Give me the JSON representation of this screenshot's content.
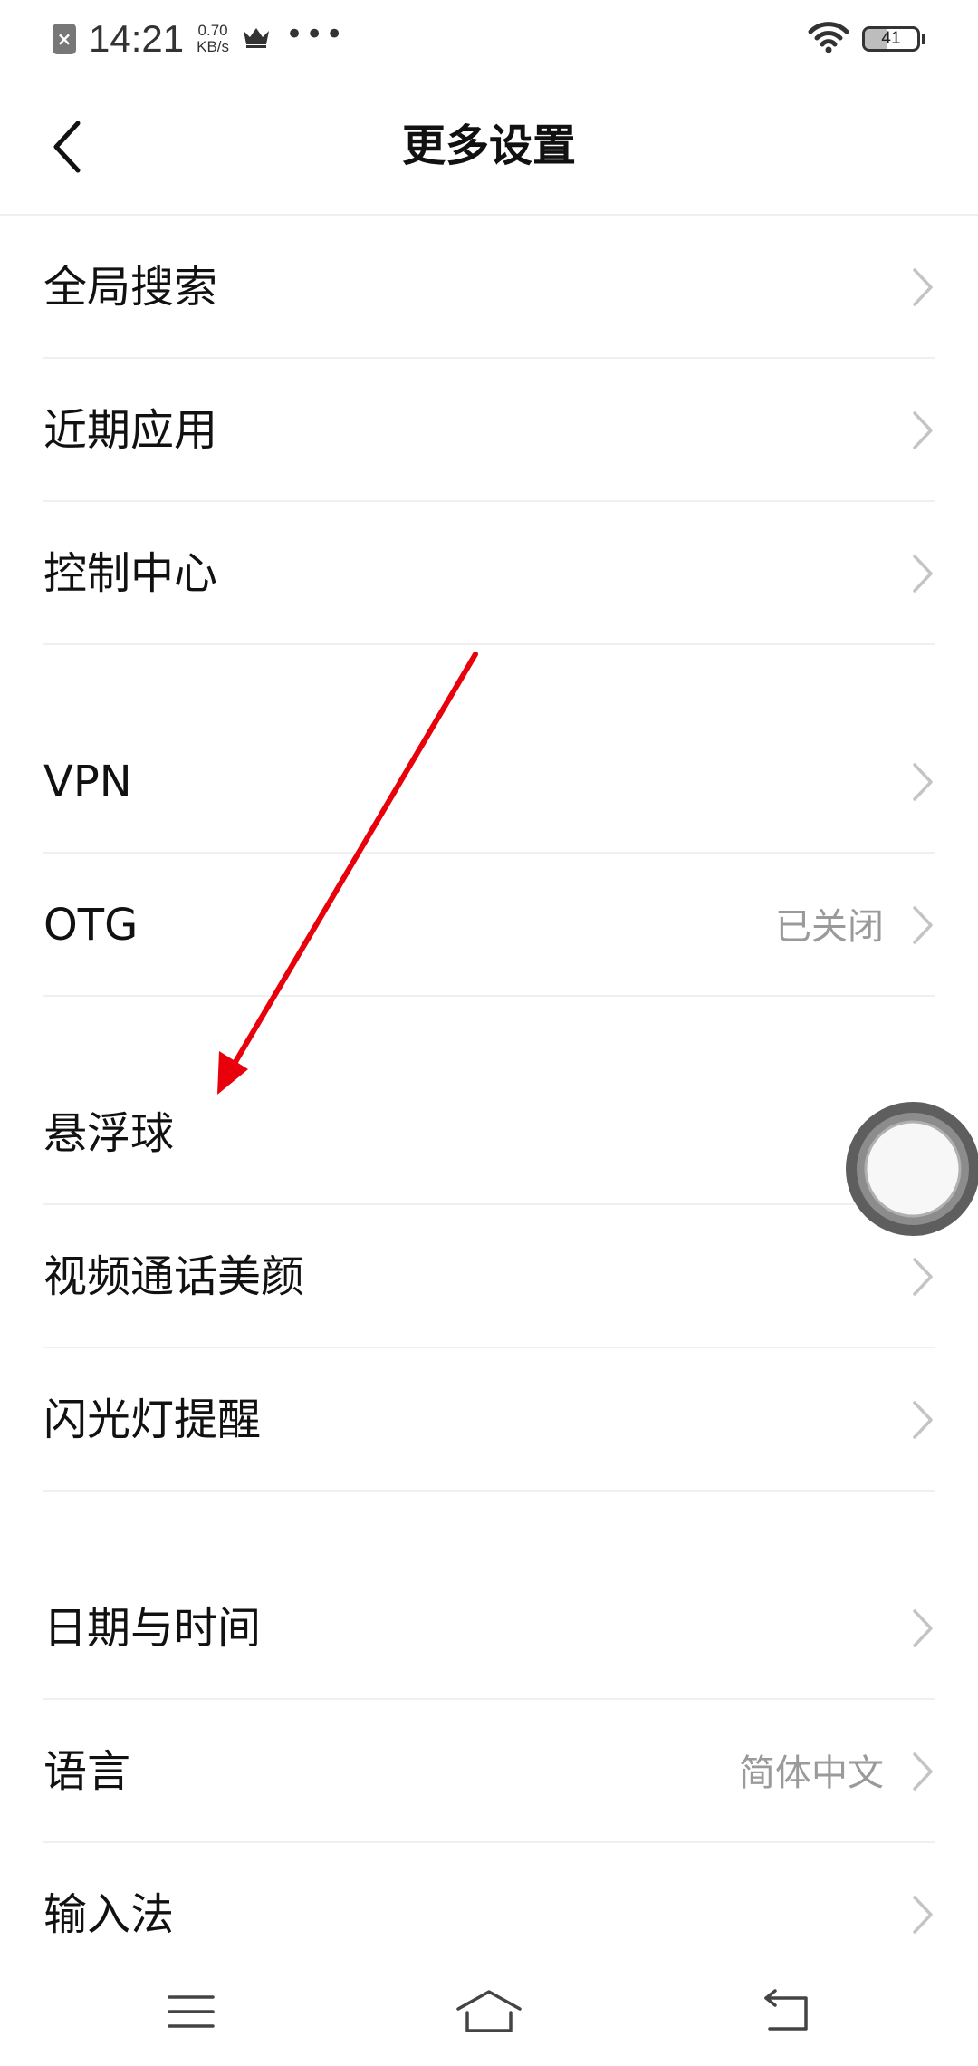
{
  "status_bar": {
    "time": "14:21",
    "speed_value": "0.70",
    "speed_unit": "KB/s",
    "more_dots": "•••",
    "battery_level": "41",
    "icons": [
      "sim-disabled-icon",
      "crown-icon",
      "wifi-icon",
      "battery-icon"
    ]
  },
  "header": {
    "title": "更多设置",
    "back_icon": "chevron-left-icon"
  },
  "groups": [
    {
      "items": [
        {
          "label": "全局搜索",
          "value": ""
        },
        {
          "label": "近期应用",
          "value": ""
        },
        {
          "label": "控制中心",
          "value": ""
        }
      ]
    },
    {
      "items": [
        {
          "label": "VPN",
          "value": ""
        },
        {
          "label": "OTG",
          "value": "已关闭"
        }
      ]
    },
    {
      "items": [
        {
          "label": "悬浮球",
          "value": ""
        },
        {
          "label": "视频通话美颜",
          "value": ""
        },
        {
          "label": "闪光灯提醒",
          "value": ""
        }
      ]
    },
    {
      "items": [
        {
          "label": "日期与时间",
          "value": ""
        },
        {
          "label": "语言",
          "value": "简体中文"
        },
        {
          "label": "输入法",
          "value": ""
        }
      ]
    }
  ],
  "nav_bar": {
    "icons": [
      "menu-icon",
      "home-icon",
      "back-icon"
    ]
  },
  "colors": {
    "annotation_arrow": "#e8000b",
    "secondary_text": "#9a9a9a",
    "chevron": "#c4c4c4",
    "divider": "#f0f0f0"
  }
}
